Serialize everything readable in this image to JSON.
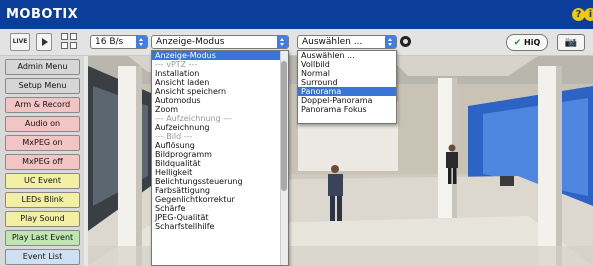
{
  "header": {
    "logo": "MOBOTIX"
  },
  "toolbar": {
    "live_label": "LIVE",
    "fps_value": "16 B/s",
    "mode_value": "Anzeige-Modus",
    "view_value": "Auswählen ...",
    "hiq_label": "HiQ"
  },
  "sidebar": {
    "items": [
      {
        "label": "Admin Menu",
        "color": "#d6d6d6"
      },
      {
        "label": "Setup Menu",
        "color": "#d6d6d6"
      },
      {
        "label": "Arm & Record",
        "color": "#f3c4c4"
      },
      {
        "label": "Audio on",
        "color": "#f3c4c4"
      },
      {
        "label": "MxPEG on",
        "color": "#f3c4c4"
      },
      {
        "label": "MxPEG off",
        "color": "#f3c4c4"
      },
      {
        "label": "UC Event",
        "color": "#f3f0a6"
      },
      {
        "label": "LEDs Blink",
        "color": "#f3f0a6"
      },
      {
        "label": "Play Sound",
        "color": "#f3f0a6"
      },
      {
        "label": "Play Last Event",
        "color": "#bfe6b0"
      },
      {
        "label": "Event List",
        "color": "#cfe0f3"
      }
    ]
  },
  "mode_dropdown": {
    "items": [
      "Anzeige-Modus",
      "--- vPTZ ---",
      "Installation",
      "Ansicht laden",
      "Ansicht speichern",
      "Automodus",
      "Zoom",
      "--- Aufzeichnung ---",
      "Aufzeichnung",
      "--- Bild ---",
      "Auflösung",
      "Bildprogramm",
      "Bildqualität",
      "Helligkeit",
      "Belichtungssteuerung",
      "Farbsättigung",
      "Gegenlichtkorrektur",
      "Schärfe",
      "JPEG-Qualität",
      "Scharfstellhilfe"
    ],
    "selected": "Anzeige-Modus"
  },
  "view_dropdown": {
    "items": [
      "Auswählen ...",
      "Vollbild",
      "Normal",
      "Surround",
      "Panorama",
      "Doppel-Panorama",
      "Panorama Fokus"
    ],
    "selected": "Panorama"
  },
  "colors": {
    "header_bg": "#0a3e9a",
    "accent_blue": "#3875d7",
    "logo_text": "#ffffff"
  }
}
